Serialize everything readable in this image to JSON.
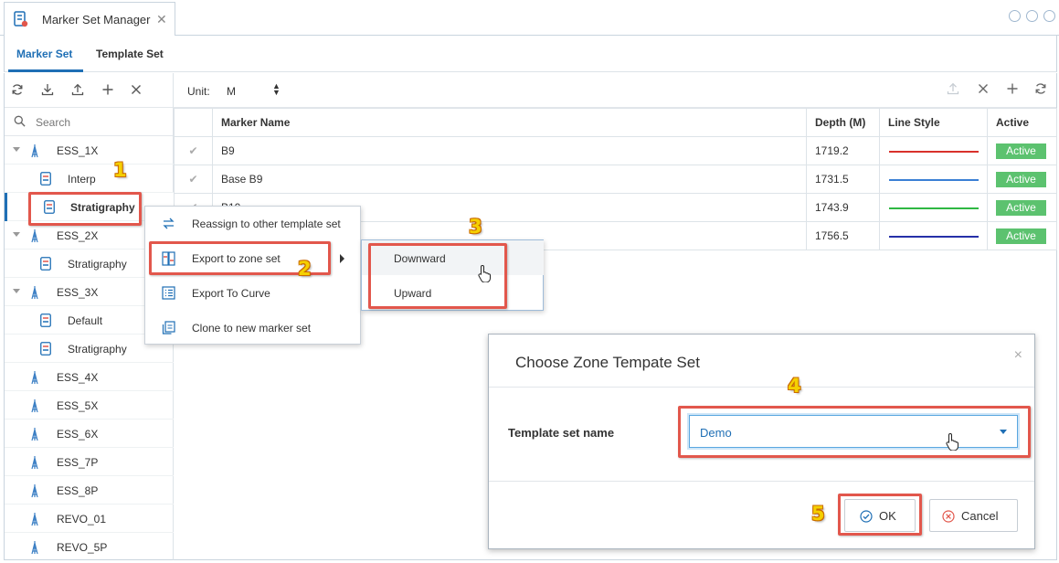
{
  "window": {
    "tab_title": "Marker Set Manager",
    "close_glyph": "✕"
  },
  "section_tabs": [
    {
      "label": "Marker Set",
      "active": true
    },
    {
      "label": "Template Set",
      "active": false
    }
  ],
  "left_toolbar": {
    "icons": [
      "refresh-icon",
      "download-icon",
      "upload-icon",
      "plus-icon",
      "close-icon"
    ]
  },
  "search": {
    "placeholder": "Search"
  },
  "tree": [
    {
      "label": "ESS_1X",
      "type": "well",
      "expanded": true
    },
    {
      "label": "Interp",
      "type": "marker-set"
    },
    {
      "label": "Stratigraphy",
      "type": "marker-set",
      "selected": true
    },
    {
      "label": "ESS_2X",
      "type": "well",
      "expanded": true
    },
    {
      "label": "Stratigraphy",
      "type": "marker-set"
    },
    {
      "label": "ESS_3X",
      "type": "well",
      "expanded": true
    },
    {
      "label": "Default",
      "type": "marker-set"
    },
    {
      "label": "Stratigraphy",
      "type": "marker-set"
    },
    {
      "label": "ESS_4X",
      "type": "well"
    },
    {
      "label": "ESS_5X",
      "type": "well"
    },
    {
      "label": "ESS_6X",
      "type": "well"
    },
    {
      "label": "ESS_7P",
      "type": "well"
    },
    {
      "label": "ESS_8P",
      "type": "well"
    },
    {
      "label": "REVO_01",
      "type": "well"
    },
    {
      "label": "REVO_5P",
      "type": "well"
    }
  ],
  "right_toolbar": {
    "unit_label": "Unit:",
    "unit_value": "M",
    "unit_arrows": "▲▼",
    "icons": [
      "export-icon",
      "close-icon",
      "plus-icon",
      "refresh-icon"
    ]
  },
  "table": {
    "headers": [
      "",
      "Marker Name",
      "Depth (M)",
      "Line Style",
      "Active"
    ],
    "rows": [
      {
        "check": "✔",
        "name": "B9",
        "depth": "1719.2",
        "color": "#d9312b",
        "active": "Active"
      },
      {
        "check": "✔",
        "name": "Base B9",
        "depth": "1731.5",
        "color": "#3a7fd5",
        "active": "Active"
      },
      {
        "check": "✔",
        "name": "B10",
        "depth": "1743.9",
        "color": "#2fb843",
        "active": "Active"
      },
      {
        "check": "✔",
        "name": "",
        "depth": "1756.5",
        "color": "#2630a8",
        "active": "Active"
      }
    ]
  },
  "context_menu": {
    "items": [
      {
        "label": "Reassign to other template set",
        "icon": "reassign-icon"
      },
      {
        "label": "Export to zone set",
        "icon": "export-zone-icon",
        "has_submenu": true
      },
      {
        "label": "Export To Curve",
        "icon": "curve-list-icon"
      },
      {
        "label": "Clone to new marker set",
        "icon": "clone-icon"
      }
    ]
  },
  "submenu": {
    "items": [
      {
        "label": "Downward"
      },
      {
        "label": "Upward"
      }
    ]
  },
  "dialog": {
    "title": "Choose Zone Tempate Set",
    "close_glyph": "×",
    "field_label": "Template set name",
    "field_value": "Demo",
    "ok_label": "OK",
    "cancel_label": "Cancel"
  },
  "annotations": [
    "1",
    "2",
    "3",
    "4",
    "5"
  ],
  "colors": {
    "accent": "#1f6fb5",
    "active_badge": "#5cc26f",
    "annotation_box": "#e2574c",
    "annotation_number": "#f5d000"
  }
}
